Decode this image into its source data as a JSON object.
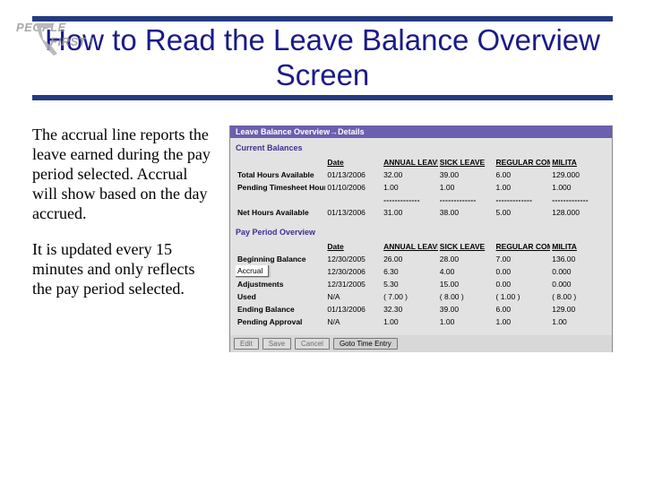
{
  "logo": {
    "line1": "PEOPLE",
    "line2": "FIRST !"
  },
  "title": "How to Read the Leave Balance Overview Screen",
  "body": {
    "p1": "The accrual line reports the leave earned during the pay period selected. Accrual will show based on the day accrued.",
    "p2": "It is updated every 15 minutes and only reflects the pay period selected."
  },
  "screenshot": {
    "titlebar": "Leave Balance Overview→Details",
    "section1": {
      "heading": "Current Balances",
      "columns": [
        "",
        "Date",
        "ANNUAL LEAVE",
        "SICK LEAVE",
        "REGULAR COMP LEAVE",
        "MILITA"
      ],
      "rows": [
        {
          "label": "Total Hours Available",
          "date": "01/13/2006",
          "vals": [
            "32.00",
            "39.00",
            "6.00",
            "129.000"
          ]
        },
        {
          "label": "Pending Timesheet Hours",
          "date": "01/10/2006",
          "vals": [
            "1.00",
            "1.00",
            "1.00",
            "1.000"
          ]
        },
        {
          "label": "",
          "date": "",
          "vals": [
            "-------------",
            "-------------",
            "-------------",
            "-------------"
          ],
          "dash": true
        },
        {
          "label": "Net Hours Available",
          "date": "01/13/2006",
          "vals": [
            "31.00",
            "38.00",
            "5.00",
            "128.000"
          ]
        }
      ]
    },
    "section2": {
      "heading": "Pay Period Overview",
      "columns": [
        "",
        "Date",
        "ANNUAL LEAVE",
        "SICK LEAVE",
        "REGULAR COMP LEAVE",
        "MILITA"
      ],
      "rows": [
        {
          "label": "Beginning Balance",
          "date": "12/30/2005",
          "vals": [
            "26.00",
            "28.00",
            "7.00",
            "136.00"
          ]
        },
        {
          "label": "Accrual",
          "date": "12/30/2006",
          "vals": [
            "6.30",
            "4.00",
            "0.00",
            "0.000"
          ],
          "boxed": true
        },
        {
          "label": "Adjustments",
          "date": "12/31/2005",
          "vals": [
            "5.30",
            "15.00",
            "0.00",
            "0.000"
          ]
        },
        {
          "label": "Used",
          "date": "N/A",
          "vals": [
            "( 7.00 )",
            "( 8.00 )",
            "( 1.00 )",
            "( 8.00 )"
          ]
        },
        {
          "label": "Ending Balance",
          "date": "01/13/2006",
          "vals": [
            "32.30",
            "39.00",
            "6.00",
            "129.00"
          ]
        },
        {
          "label": "Pending Approval",
          "date": "N/A",
          "vals": [
            "1.00",
            "1.00",
            "1.00",
            "1.00"
          ]
        }
      ]
    },
    "buttons": {
      "edit": "Edit",
      "save": "Save",
      "cancel": "Cancel",
      "goto": "Goto Time Entry"
    }
  }
}
